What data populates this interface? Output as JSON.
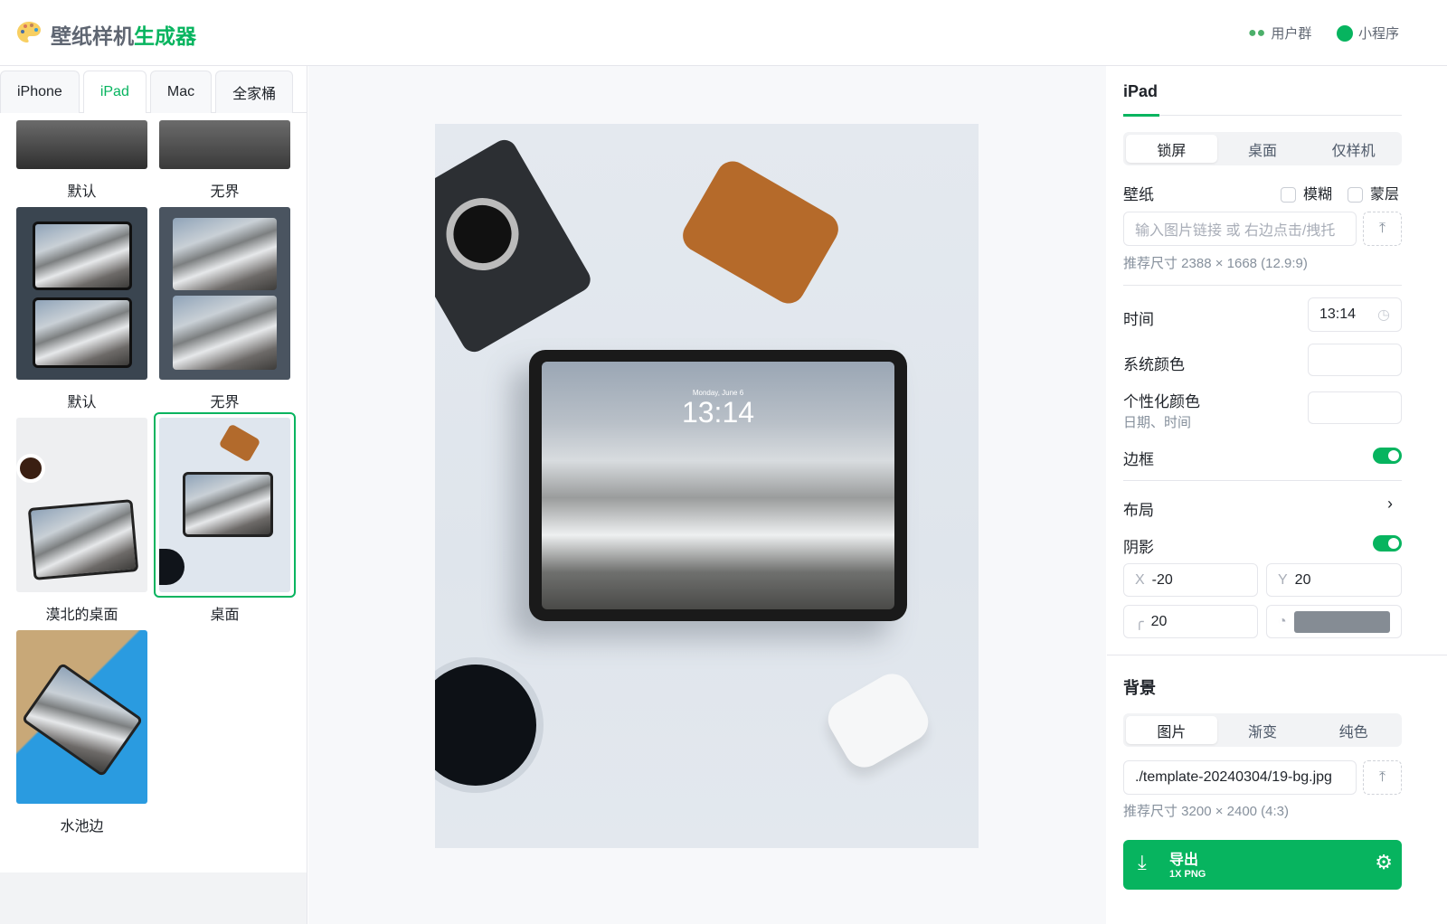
{
  "header": {
    "title_main": "壁纸样机",
    "title_accent": "生成器",
    "links": [
      {
        "label": "用户群",
        "icon": "wechat-icon"
      },
      {
        "label": "小程序",
        "icon": "mini-program-icon"
      }
    ]
  },
  "device_tabs": [
    {
      "label": "iPhone"
    },
    {
      "label": "iPad",
      "active": true
    },
    {
      "label": "Mac"
    },
    {
      "label": "全家桶"
    }
  ],
  "templates": [
    {
      "label": "默认"
    },
    {
      "label": "无界"
    },
    {
      "label": "默认"
    },
    {
      "label": "无界"
    },
    {
      "label": "漠北的桌面"
    },
    {
      "label": "桌面",
      "selected": true
    },
    {
      "label": "水池边"
    }
  ],
  "preview": {
    "lock_date": "Monday, June 6",
    "lock_time": "13:14"
  },
  "panel": {
    "title": "iPad",
    "mode_tabs": [
      {
        "label": "锁屏",
        "active": true
      },
      {
        "label": "桌面"
      },
      {
        "label": "仅样机"
      }
    ],
    "wallpaper": {
      "label": "壁纸",
      "blur_label": "模糊",
      "mask_label": "蒙层",
      "placeholder": "输入图片链接 或 右边点击/拽托",
      "hint": "推荐尺寸 2388 × 1668 (12.9:9)"
    },
    "time": {
      "label": "时间",
      "value": "13:14"
    },
    "system_color": {
      "label": "系统颜色"
    },
    "custom_color": {
      "label": "个性化颜色",
      "sub": "日期、时间"
    },
    "border": {
      "label": "边框",
      "enabled": true
    },
    "layout": {
      "label": "布局"
    },
    "shadow": {
      "label": "阴影",
      "enabled": true,
      "x_label": "X",
      "x": "-20",
      "y_label": "Y",
      "y": "20",
      "radius": "20",
      "color": "#858c94"
    },
    "background": {
      "title": "背景",
      "tabs": [
        {
          "label": "图片",
          "active": true
        },
        {
          "label": "渐变"
        },
        {
          "label": "纯色"
        }
      ],
      "value": "./template-20240304/19-bg.jpg",
      "hint": "推荐尺寸 3200 × 2400 (4:3)"
    },
    "export": {
      "label": "导出",
      "sub": "1X PNG"
    }
  },
  "colors": {
    "accent": "#07b45f"
  }
}
